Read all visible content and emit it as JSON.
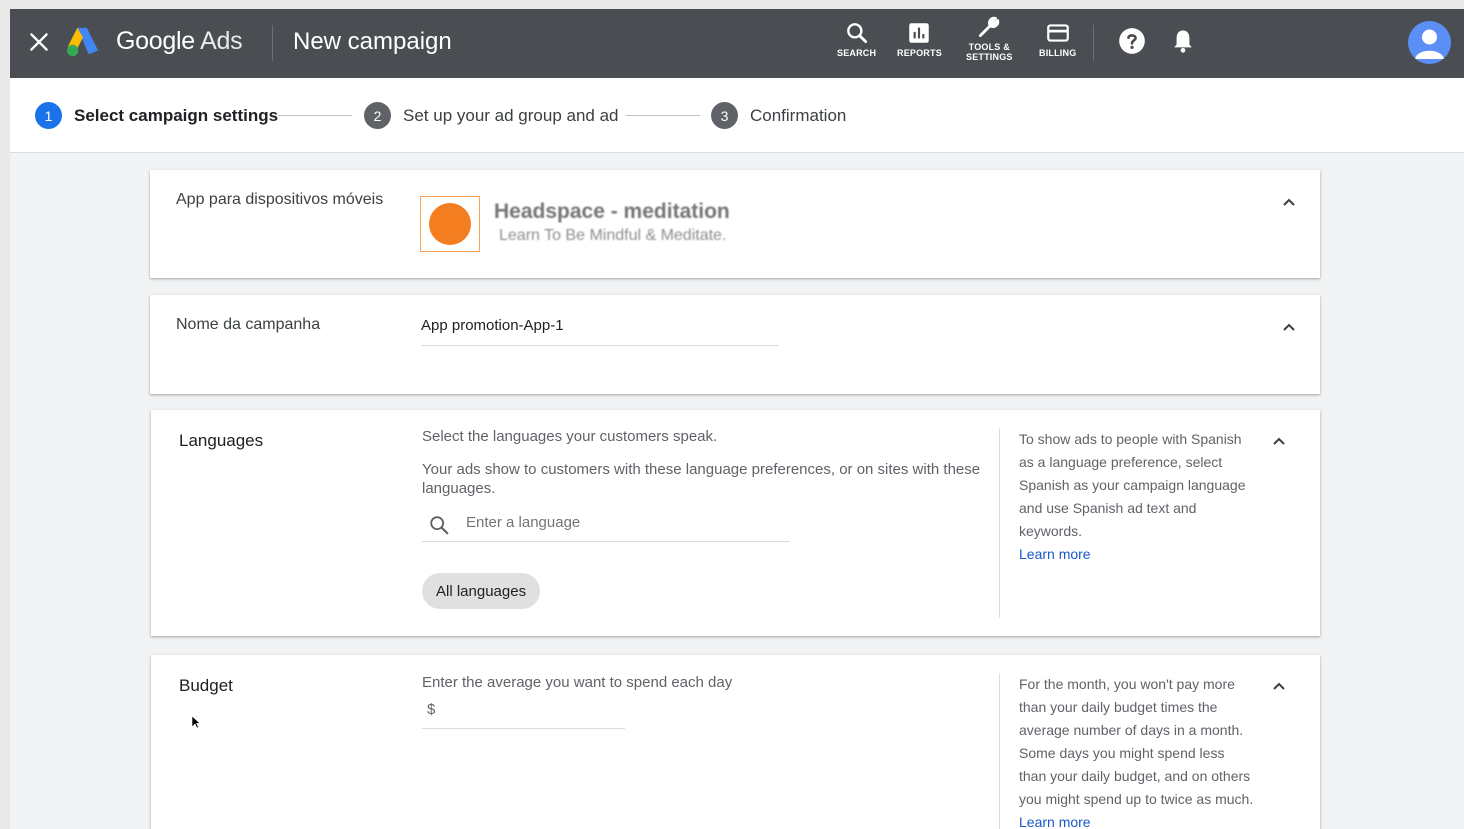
{
  "topbar": {
    "brand_google": "Google",
    "brand_ads": "Ads",
    "page_title": "New campaign",
    "tools": [
      {
        "label": "SEARCH",
        "icon": "search-icon"
      },
      {
        "label": "REPORTS",
        "icon": "reports-icon"
      },
      {
        "label_line1": "TOOLS &",
        "label_line2": "SETTINGS",
        "icon": "wrench-icon"
      },
      {
        "label": "BILLING",
        "icon": "billing-card-icon"
      }
    ],
    "colors": {
      "bar": "#4a4d51",
      "avatar": "#5b8ff5"
    }
  },
  "stepper": {
    "steps": [
      {
        "num": "1",
        "label": "Select campaign settings",
        "active": true
      },
      {
        "num": "2",
        "label": "Set up your ad group and ad",
        "active": false
      },
      {
        "num": "3",
        "label": "Confirmation",
        "active": false
      }
    ],
    "accent": "#1a73e8"
  },
  "app_card": {
    "label": "App para dispositivos móveis",
    "app_name": "Headspace - meditation",
    "app_subtitle": "Learn To Be Mindful & Meditate."
  },
  "name_card": {
    "label": "Nome da campanha",
    "value": "App promotion-App-1"
  },
  "languages_card": {
    "label": "Languages",
    "intro": "Select the languages your customers speak.",
    "desc": "Your ads show to customers with these language preferences, or on sites with these languages.",
    "search_placeholder": "Enter a language",
    "chip": "All languages",
    "help": "To show ads to people with Spanish as a language preference, select Spanish as your campaign language and use Spanish ad text and keywords.",
    "learn_more": "Learn more"
  },
  "budget_card": {
    "label": "Budget",
    "intro": "Enter the average you want to spend each day",
    "currency": "$",
    "help": "For the month, you won't pay more than your daily budget times the average number of days in a month. Some days you might spend less than your daily budget, and on others you might spend up to twice as much.",
    "learn_more": "Learn more"
  }
}
